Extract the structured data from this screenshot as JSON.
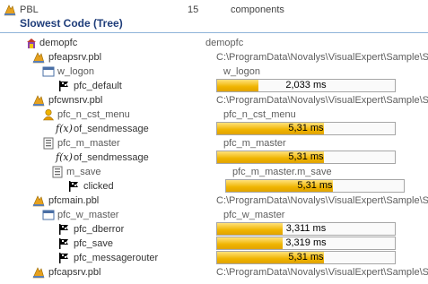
{
  "header": {
    "label": "PBL",
    "count": "15",
    "kind": "components"
  },
  "title": "Slowest Code (Tree)",
  "tree": {
    "root": {
      "label": "demopfc",
      "col2": "demopfc"
    },
    "lib_pfeapsrv": {
      "label": "pfeapsrv.pbl",
      "col2": "C:\\ProgramData\\Novalys\\VisualExpert\\Sample\\S"
    },
    "w_logon": {
      "label": "w_logon",
      "col2": "w_logon"
    },
    "pfc_default": {
      "label": "pfc_default",
      "value": "2,033 ms",
      "fill": 0.23
    },
    "lib_pfcwnsrv": {
      "label": "pfcwnsrv.pbl",
      "col2": "C:\\ProgramData\\Novalys\\VisualExpert\\Sample\\S"
    },
    "pfc_n_cst_menu": {
      "label": "pfc_n_cst_menu",
      "col2": "pfc_n_cst_menu"
    },
    "of_sendmessage_1": {
      "label": "of_sendmessage",
      "value": "5,31 ms",
      "fill": 0.6
    },
    "pfc_m_master": {
      "label": "pfc_m_master",
      "col2": "pfc_m_master"
    },
    "of_sendmessage_2": {
      "label": "of_sendmessage",
      "value": "5,31 ms",
      "fill": 0.6
    },
    "m_save": {
      "label": "m_save",
      "col2": "pfc_m_master.m_save"
    },
    "clicked": {
      "label": "clicked",
      "value": "5,31 ms",
      "fill": 0.6
    },
    "lib_pfcmain": {
      "label": "pfcmain.pbl",
      "col2": "C:\\ProgramData\\Novalys\\VisualExpert\\Sample\\S"
    },
    "pfc_w_master": {
      "label": "pfc_w_master",
      "col2": "pfc_w_master"
    },
    "pfc_dberror": {
      "label": "pfc_dberror",
      "value": "3,311 ms",
      "fill": 0.37
    },
    "pfc_save": {
      "label": "pfc_save",
      "value": "3,319 ms",
      "fill": 0.37
    },
    "pfc_messagerouter": {
      "label": "pfc_messagerouter",
      "value": "5,31 ms",
      "fill": 0.6
    },
    "lib_pfcapsrv": {
      "label": "pfcapsrv.pbl",
      "col2": "C:\\ProgramData\\Novalys\\VisualExpert\\Sample\\S"
    }
  },
  "colors": {
    "library": "#e6a11f",
    "accent_bar": "#f0b400",
    "title": "#1f3d7a"
  }
}
